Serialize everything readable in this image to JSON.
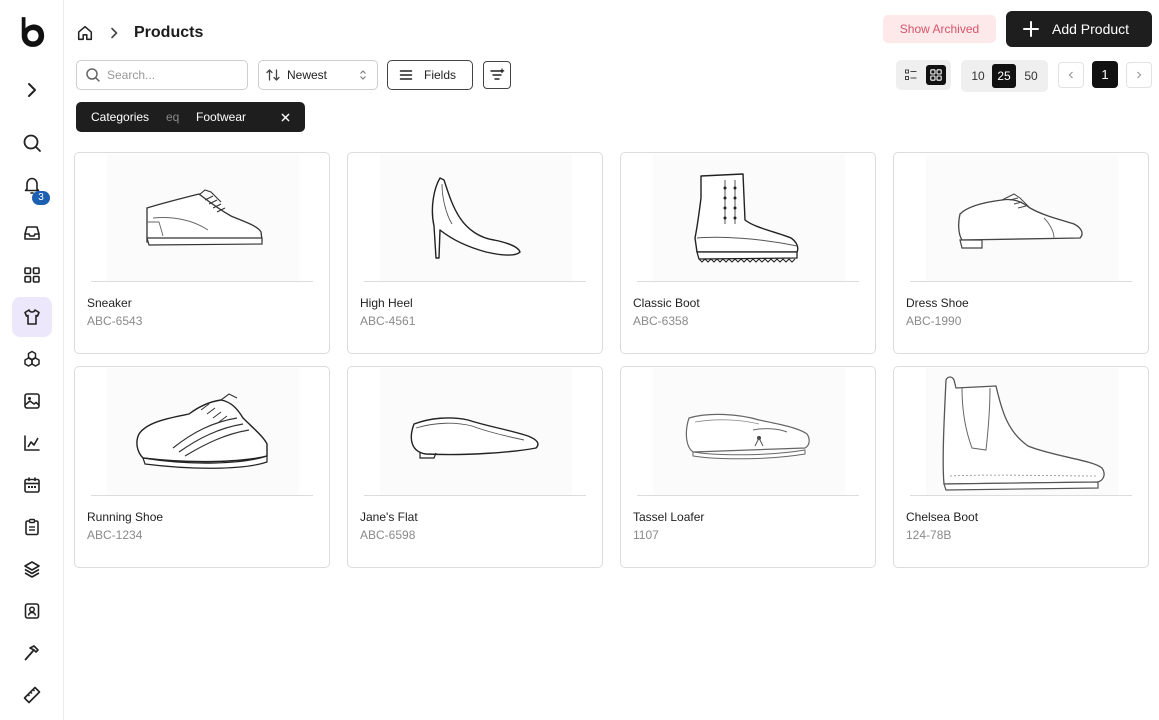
{
  "breadcrumb": {
    "title": "Products"
  },
  "header": {
    "show_archived_label": "Show Archived",
    "add_product_label": "Add Product"
  },
  "toolbar": {
    "search_placeholder": "Search...",
    "sort_value": "Newest",
    "fields_label": "Fields",
    "page_sizes": [
      "10",
      "25",
      "50"
    ],
    "selected_page_size": "25",
    "current_page": "1"
  },
  "sidebar": {
    "notification_count": "3"
  },
  "filter": {
    "field": "Categories",
    "operator": "eq",
    "value": "Footwear"
  },
  "products": [
    {
      "name": "Sneaker",
      "sku": "ABC-6543",
      "image": "sneaker"
    },
    {
      "name": "High Heel",
      "sku": "ABC-4561",
      "image": "high-heel"
    },
    {
      "name": "Classic Boot",
      "sku": "ABC-6358",
      "image": "boot"
    },
    {
      "name": "Dress Shoe",
      "sku": "ABC-1990",
      "image": "dress-shoe"
    },
    {
      "name": "Running Shoe",
      "sku": "ABC-1234",
      "image": "running-shoe"
    },
    {
      "name": "Jane's Flat",
      "sku": "ABC-6598",
      "image": "flat"
    },
    {
      "name": "Tassel Loafer",
      "sku": "1107",
      "image": "loafer"
    },
    {
      "name": "Chelsea Boot",
      "sku": "124-78B",
      "image": "chelsea-boot"
    }
  ]
}
